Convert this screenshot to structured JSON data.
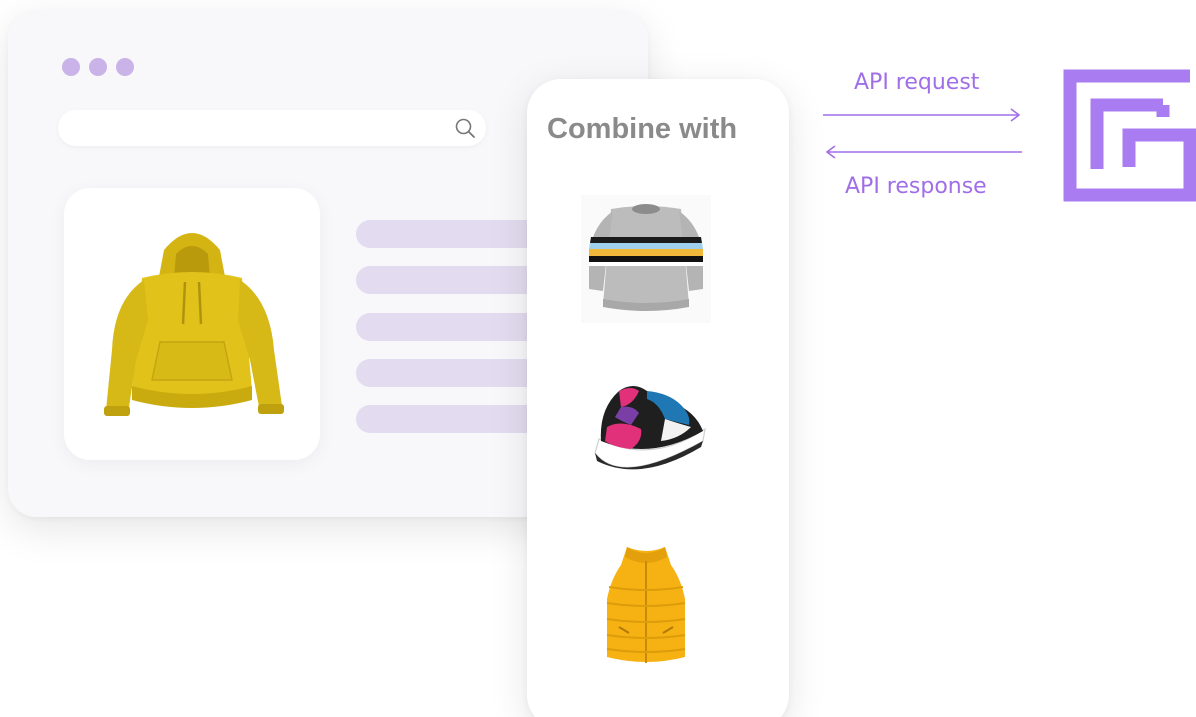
{
  "panel": {
    "title": "Combine with"
  },
  "api": {
    "request_label": "API request",
    "response_label": "API response"
  },
  "colors": {
    "accent": "#a06fe8",
    "dot": "#c9b3e8",
    "placeholder_line": "#e3dbef",
    "hoodie": "#e0c21a",
    "vest": "#f5b212"
  },
  "icons": {
    "search": "search-icon",
    "logo": "brand-logo-icon",
    "main_product": "yellow-hoodie-image",
    "recommendations": [
      "striped-sweater-image",
      "sneaker-image",
      "yellow-puffer-vest-image"
    ]
  }
}
